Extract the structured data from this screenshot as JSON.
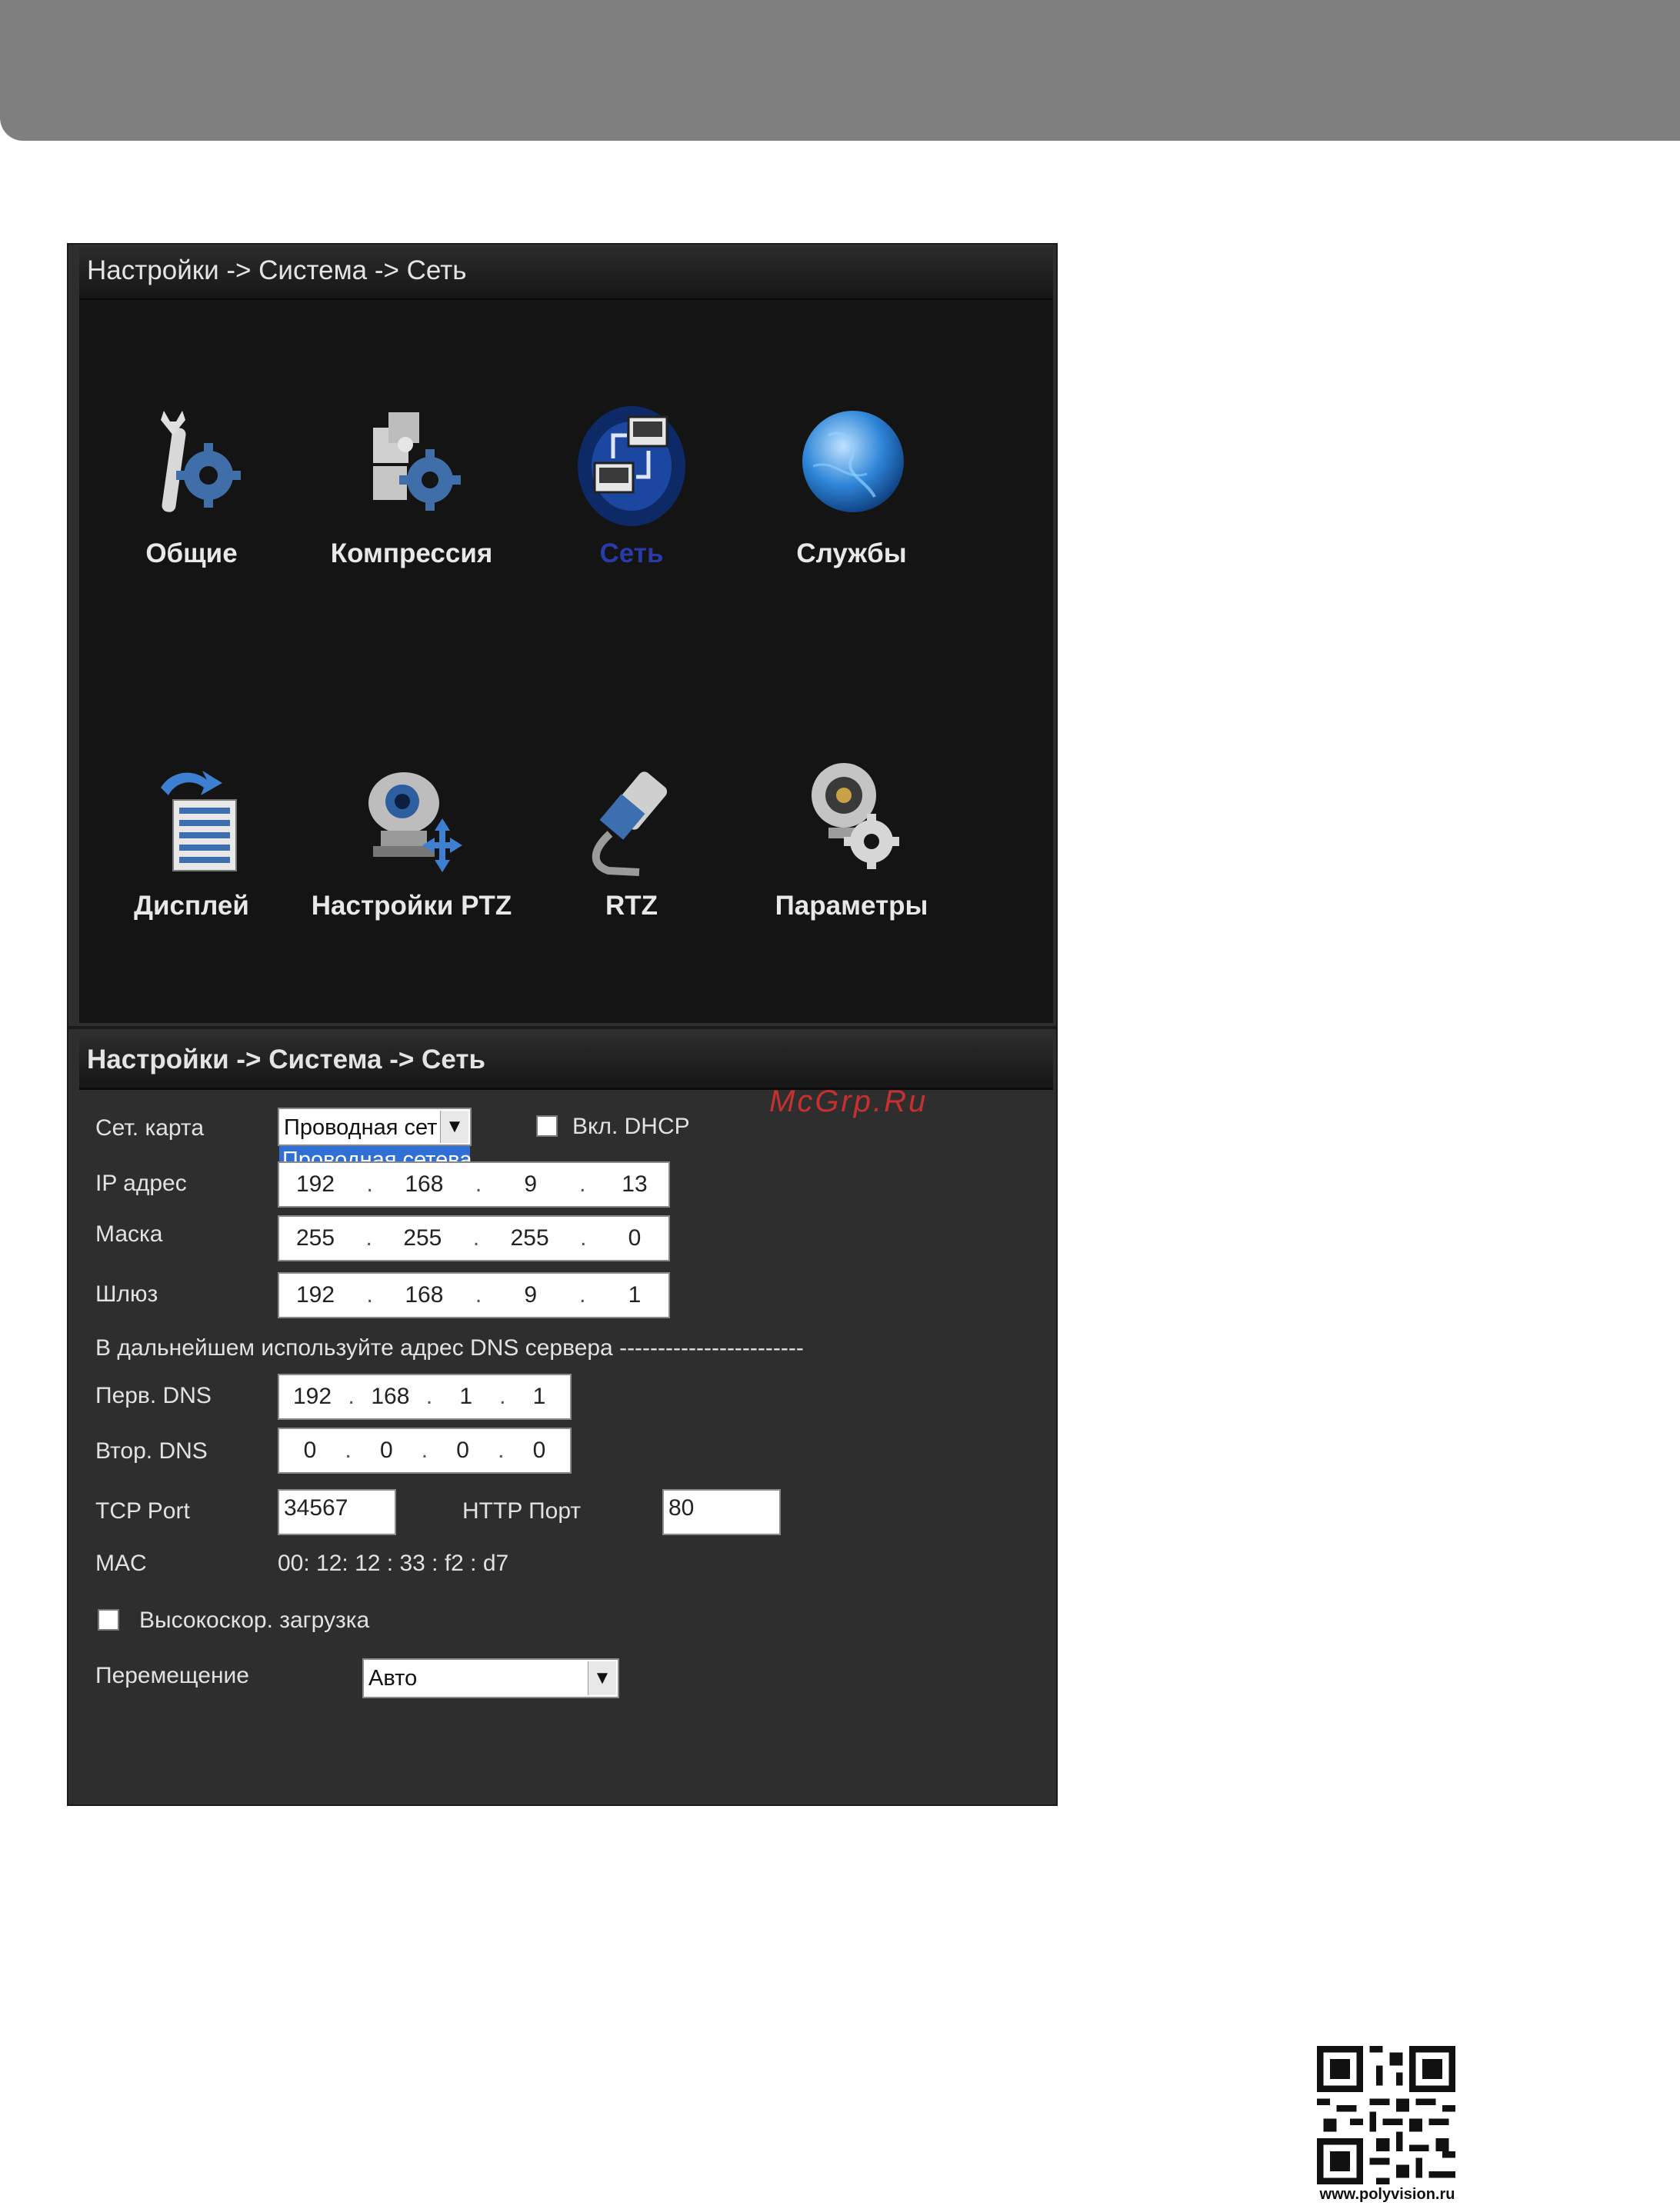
{
  "panel1": {
    "title": "Настройки -> Система -> Сеть",
    "items": [
      {
        "label": "Общие",
        "icon": "wrench-gear-icon"
      },
      {
        "label": "Компрессия",
        "icon": "puzzle-gear-icon"
      },
      {
        "label": "Сеть",
        "icon": "network-icon",
        "active": true
      },
      {
        "label": "Службы",
        "icon": "globe-icon"
      },
      {
        "label": "Дисплей",
        "icon": "display-list-icon"
      },
      {
        "label": "Настройки PTZ",
        "icon": "ptz-camera-icon"
      },
      {
        "label": "RTZ",
        "icon": "cable-connector-icon"
      },
      {
        "label": "Параметры",
        "icon": "webcam-gear-icon"
      }
    ]
  },
  "panel2": {
    "title": "Настройки -> Система -> Сеть",
    "net_card": {
      "label": "Сет. карта",
      "value": "Проводная сет",
      "dropdown_option": "Проводная сетева"
    },
    "dhcp": {
      "label": "Вкл. DHCP",
      "checked": false
    },
    "ip": {
      "label": "IP адрес",
      "octets": [
        "192",
        "168",
        "9",
        "13"
      ]
    },
    "mask": {
      "label": "Маска",
      "octets": [
        "255",
        "255",
        "255",
        "0"
      ]
    },
    "gateway": {
      "label": "Шлюз",
      "octets": [
        "192",
        "168",
        "9",
        "1"
      ]
    },
    "dns_heading": "В дальнейшем используйте адрес DNS сервера ------------------------",
    "dns1": {
      "label": "Перв. DNS",
      "octets": [
        "192",
        "168",
        "1",
        "1"
      ]
    },
    "dns2": {
      "label": "Втор. DNS",
      "octets": [
        "0",
        "0",
        "0",
        "0"
      ]
    },
    "tcp": {
      "label": "TCP Port",
      "value": "34567"
    },
    "http": {
      "label": "HTTP Порт",
      "value": "80"
    },
    "mac": {
      "label": "MAC",
      "value": "00:  12:   12 :   33  :   f2  :  d7"
    },
    "highspeed": {
      "label": "Высокоскор. загрузка",
      "checked": false
    },
    "transfer": {
      "label": "Перемещение",
      "value": "Авто"
    }
  },
  "watermark": "McGrp.Ru",
  "qr_caption": "www.polyvision.ru"
}
